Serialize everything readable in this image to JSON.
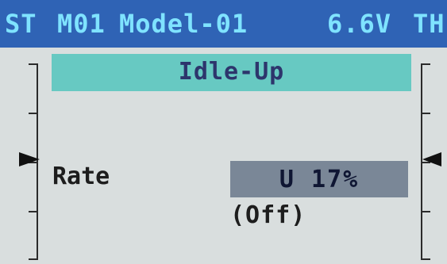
{
  "header": {
    "left_indicator": "ST",
    "model_number": "M01",
    "model_name": "Model-01",
    "voltage": "6.6V",
    "right_indicator": "TH"
  },
  "screen": {
    "title": "Idle-Up"
  },
  "setting": {
    "label": "Rate",
    "value": "U 17%",
    "status": "(Off)"
  },
  "colors": {
    "status_bar": "#2f63b5",
    "status_text": "#7fe3ff",
    "title_bar": "#67c9c2",
    "title_text": "#2d356c",
    "value_box": "#7a8797",
    "background": "#d9dede"
  }
}
